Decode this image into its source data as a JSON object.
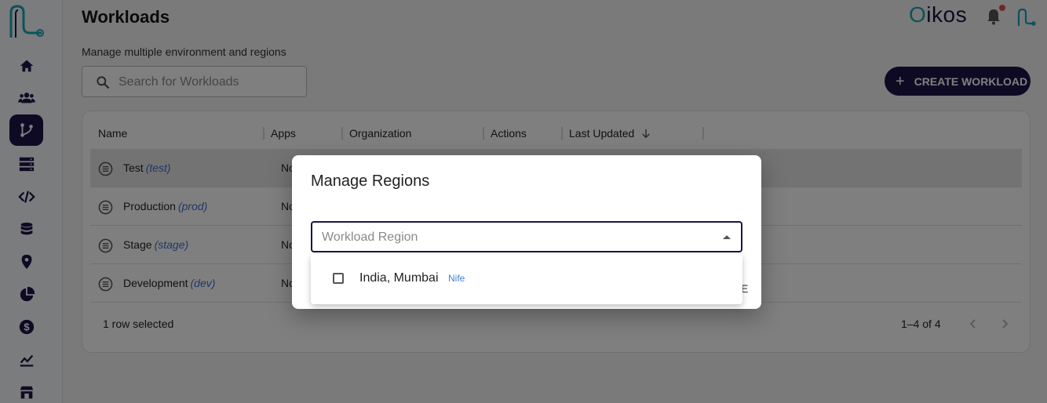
{
  "brand": {
    "name_first": "O",
    "name_rest": "ikos"
  },
  "sidebar": {
    "items": [
      {
        "icon": "home-icon"
      },
      {
        "icon": "users-icon"
      },
      {
        "icon": "workloads-branch-icon",
        "active": true
      },
      {
        "icon": "server-icon"
      },
      {
        "icon": "code-icon"
      },
      {
        "icon": "database-icon"
      },
      {
        "icon": "location-pin-icon"
      },
      {
        "icon": "pie-chart-icon"
      },
      {
        "icon": "dollar-icon"
      },
      {
        "icon": "trend-chart-icon"
      },
      {
        "icon": "store-icon"
      }
    ]
  },
  "header": {
    "title": "Workloads",
    "subtitle": "Manage multiple environment and regions",
    "search_placeholder": "Search for Workloads",
    "create_button": "Create Workload"
  },
  "table": {
    "columns": [
      "Name",
      "Apps",
      "Organization",
      "Actions",
      "Last Updated"
    ],
    "sort_icon": "arrow-down-icon",
    "rows": [
      {
        "name": "Test",
        "slug": "(test)",
        "apps": "No",
        "selected": true
      },
      {
        "name": "Production",
        "slug": "(prod)",
        "apps": "No",
        "selected": false
      },
      {
        "name": "Stage",
        "slug": "(stage)",
        "apps": "No",
        "selected": false
      },
      {
        "name": "Development",
        "slug": "(dev)",
        "apps": "No",
        "selected": false
      }
    ],
    "footer": {
      "selection": "1 row selected",
      "range": "1–4 of 4"
    },
    "obscured_text": "E"
  },
  "dialog": {
    "title": "Manage Regions",
    "field_placeholder": "Workload Region",
    "options": [
      {
        "label": "India, Mumbai",
        "tag": "Nife",
        "checked": false
      }
    ]
  },
  "colors": {
    "primary": "#1e1548",
    "accent": "#1aa6b7",
    "link": "#3f6fcf"
  }
}
